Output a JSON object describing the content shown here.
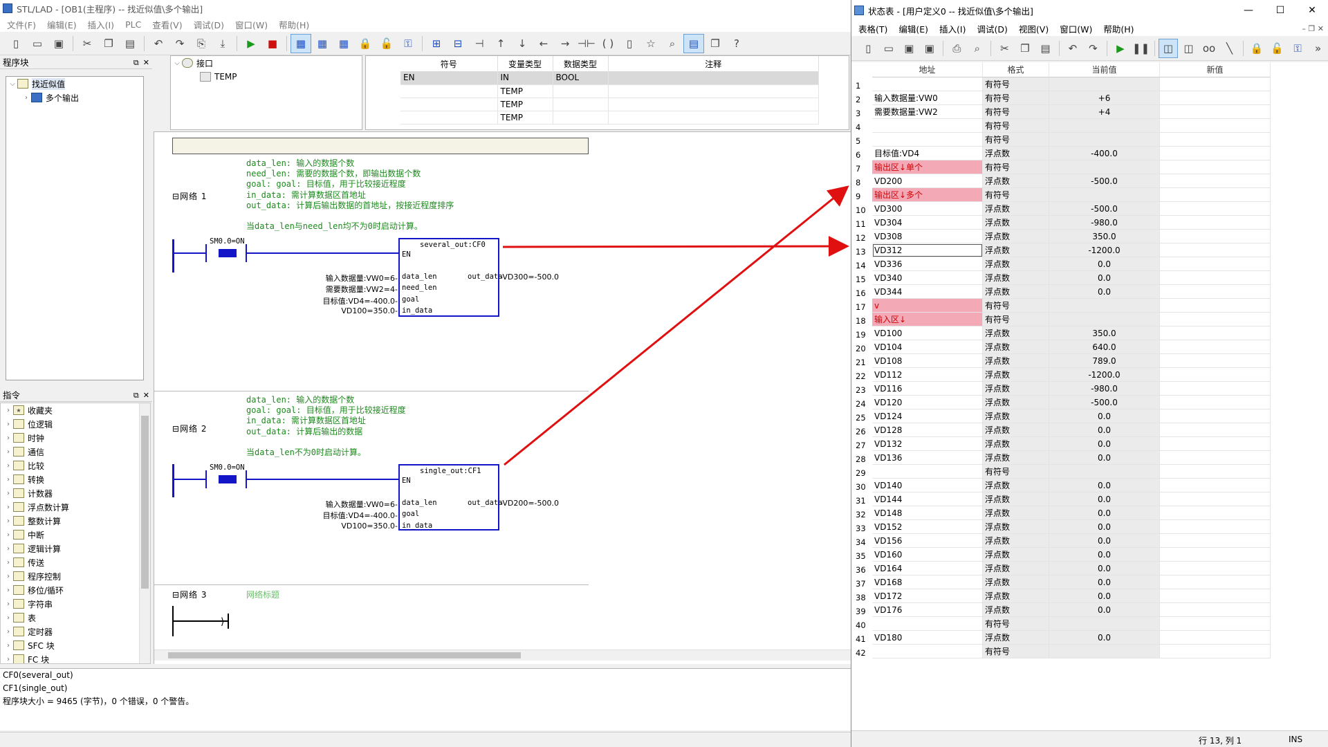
{
  "main": {
    "title": "STL/LAD - [OB1(主程序) -- 找近似值\\多个输出]",
    "menu": [
      "文件(F)",
      "编辑(E)",
      "插入(I)",
      "PLC",
      "查看(V)",
      "调试(D)",
      "窗口(W)",
      "帮助(H)"
    ],
    "program_pane": {
      "title": "程序块",
      "root": "找近似值",
      "child": "多个输出"
    },
    "instr_pane": {
      "title": "指令",
      "items": [
        "收藏夹",
        "位逻辑",
        "时钟",
        "通信",
        "比较",
        "转换",
        "计数器",
        "浮点数计算",
        "整数计算",
        "中断",
        "逻辑计算",
        "传送",
        "程序控制",
        "移位/循环",
        "字符串",
        "表",
        "定时器",
        "SFC 块",
        "FC 块"
      ]
    },
    "interface_tree": {
      "root": "接口",
      "child": "TEMP"
    },
    "interface_table": {
      "headers": [
        "符号",
        "变量类型",
        "数据类型",
        "注释"
      ],
      "rows": [
        [
          "EN",
          "IN",
          "BOOL",
          ""
        ],
        [
          "",
          "TEMP",
          "",
          ""
        ],
        [
          "",
          "TEMP",
          "",
          ""
        ],
        [
          "",
          "TEMP",
          "",
          ""
        ]
      ]
    },
    "network1": {
      "label": "网络 1",
      "comment": "data_len: 输入的数据个数\nneed_len: 需要的数据个数，即输出数据个数\ngoal: goal: 目标值，用于比较接近程度\nin_data: 需计算数据区首地址\nout_data: 计算后输出数据的首地址，按接近程度排序\n\n当data_len与need_len均不为0时启动计算。",
      "contact": "SM0.0=ON",
      "block_name": "several_out:CF0",
      "en": "EN",
      "pins_left": [
        "data_len",
        "need_len",
        "goal",
        "in_data"
      ],
      "pin_right": "out_data",
      "inputs": [
        "输入数据量:VW0=6-",
        "需要数据量:VW2=4-",
        "目标值:VD4=-400.0-",
        "VD100=350.0-"
      ],
      "output": "-VD300=-500.0"
    },
    "network2": {
      "label": "网络 2",
      "comment": "data_len: 输入的数据个数\ngoal: goal: 目标值，用于比较接近程度\nin_data: 需计算数据区首地址\nout_data: 计算后输出的数据\n\n当data_len不为0时启动计算。",
      "contact": "SM0.0=ON",
      "block_name": "single_out:CF1",
      "en": "EN",
      "pins_left": [
        "data_len",
        "goal",
        "in_data"
      ],
      "pin_right": "out_data",
      "inputs": [
        "输入数据量:VW0=6-",
        "目标值:VD4=-400.0-",
        "VD100=350.0-"
      ],
      "output": "-VD200=-500.0"
    },
    "network3": {
      "label": "网络 3",
      "title": "网络标题"
    },
    "output": [
      "CF0(several_out)",
      "CF1(single_out)",
      "程序块大小 = 9465 (字节)，0 个错误，0 个警告。"
    ]
  },
  "status": {
    "title": "状态表 - [用户定义0 -- 找近似值\\多个输出]",
    "menu": [
      "表格(T)",
      "编辑(E)",
      "插入(I)",
      "调试(D)",
      "视图(V)",
      "窗口(W)",
      "帮助(H)"
    ],
    "headers": [
      "地址",
      "格式",
      "当前值",
      "新值"
    ],
    "rows": [
      {
        "n": "1",
        "addr": "",
        "fmt": "有符号",
        "cur": ""
      },
      {
        "n": "2",
        "addr": "输入数据量:VW0",
        "fmt": "有符号",
        "cur": "+6"
      },
      {
        "n": "3",
        "addr": "需要数据量:VW2",
        "fmt": "有符号",
        "cur": "+4"
      },
      {
        "n": "4",
        "addr": "",
        "fmt": "有符号",
        "cur": ""
      },
      {
        "n": "5",
        "addr": "",
        "fmt": "有符号",
        "cur": ""
      },
      {
        "n": "6",
        "addr": "目标值:VD4",
        "fmt": "浮点数",
        "cur": "-400.0"
      },
      {
        "n": "7",
        "addr": "输出区↓单个",
        "fmt": "有符号",
        "cur": "",
        "pink": true
      },
      {
        "n": "8",
        "addr": "VD200",
        "fmt": "浮点数",
        "cur": "-500.0"
      },
      {
        "n": "9",
        "addr": "输出区↓多个",
        "fmt": "有符号",
        "cur": "",
        "pink": true
      },
      {
        "n": "10",
        "addr": "VD300",
        "fmt": "浮点数",
        "cur": "-500.0"
      },
      {
        "n": "11",
        "addr": "VD304",
        "fmt": "浮点数",
        "cur": "-980.0"
      },
      {
        "n": "12",
        "addr": "VD308",
        "fmt": "浮点数",
        "cur": "350.0"
      },
      {
        "n": "13",
        "addr": "VD312",
        "fmt": "浮点数",
        "cur": "-1200.0",
        "focus": true
      },
      {
        "n": "14",
        "addr": "VD336",
        "fmt": "浮点数",
        "cur": "0.0"
      },
      {
        "n": "15",
        "addr": "VD340",
        "fmt": "浮点数",
        "cur": "0.0"
      },
      {
        "n": "16",
        "addr": "VD344",
        "fmt": "浮点数",
        "cur": "0.0"
      },
      {
        "n": "17",
        "addr": "v",
        "fmt": "有符号",
        "cur": "",
        "pink": true
      },
      {
        "n": "18",
        "addr": "输入区↓",
        "fmt": "有符号",
        "cur": "",
        "pink": true
      },
      {
        "n": "19",
        "addr": "VD100",
        "fmt": "浮点数",
        "cur": "350.0"
      },
      {
        "n": "20",
        "addr": "VD104",
        "fmt": "浮点数",
        "cur": "640.0"
      },
      {
        "n": "21",
        "addr": "VD108",
        "fmt": "浮点数",
        "cur": "789.0"
      },
      {
        "n": "22",
        "addr": "VD112",
        "fmt": "浮点数",
        "cur": "-1200.0"
      },
      {
        "n": "23",
        "addr": "VD116",
        "fmt": "浮点数",
        "cur": "-980.0"
      },
      {
        "n": "24",
        "addr": "VD120",
        "fmt": "浮点数",
        "cur": "-500.0"
      },
      {
        "n": "25",
        "addr": "VD124",
        "fmt": "浮点数",
        "cur": "0.0"
      },
      {
        "n": "26",
        "addr": "VD128",
        "fmt": "浮点数",
        "cur": "0.0"
      },
      {
        "n": "27",
        "addr": "VD132",
        "fmt": "浮点数",
        "cur": "0.0"
      },
      {
        "n": "28",
        "addr": "VD136",
        "fmt": "浮点数",
        "cur": "0.0"
      },
      {
        "n": "29",
        "addr": "",
        "fmt": "有符号",
        "cur": ""
      },
      {
        "n": "30",
        "addr": "VD140",
        "fmt": "浮点数",
        "cur": "0.0"
      },
      {
        "n": "31",
        "addr": "VD144",
        "fmt": "浮点数",
        "cur": "0.0"
      },
      {
        "n": "32",
        "addr": "VD148",
        "fmt": "浮点数",
        "cur": "0.0"
      },
      {
        "n": "33",
        "addr": "VD152",
        "fmt": "浮点数",
        "cur": "0.0"
      },
      {
        "n": "34",
        "addr": "VD156",
        "fmt": "浮点数",
        "cur": "0.0"
      },
      {
        "n": "35",
        "addr": "VD160",
        "fmt": "浮点数",
        "cur": "0.0"
      },
      {
        "n": "36",
        "addr": "VD164",
        "fmt": "浮点数",
        "cur": "0.0"
      },
      {
        "n": "37",
        "addr": "VD168",
        "fmt": "浮点数",
        "cur": "0.0"
      },
      {
        "n": "38",
        "addr": "VD172",
        "fmt": "浮点数",
        "cur": "0.0"
      },
      {
        "n": "39",
        "addr": "VD176",
        "fmt": "浮点数",
        "cur": "0.0"
      },
      {
        "n": "40",
        "addr": "",
        "fmt": "有符号",
        "cur": ""
      },
      {
        "n": "41",
        "addr": "VD180",
        "fmt": "浮点数",
        "cur": "0.0"
      },
      {
        "n": "42",
        "addr": "",
        "fmt": "有符号",
        "cur": ""
      }
    ],
    "statusbar": {
      "pos": "行 13, 列 1",
      "mode": "INS"
    }
  },
  "colors": {
    "ladder_blue": "#1515c8",
    "arrow_red": "#e01010",
    "pink_row": "#f4a9b6",
    "comment_green": "#1d8a1d"
  }
}
